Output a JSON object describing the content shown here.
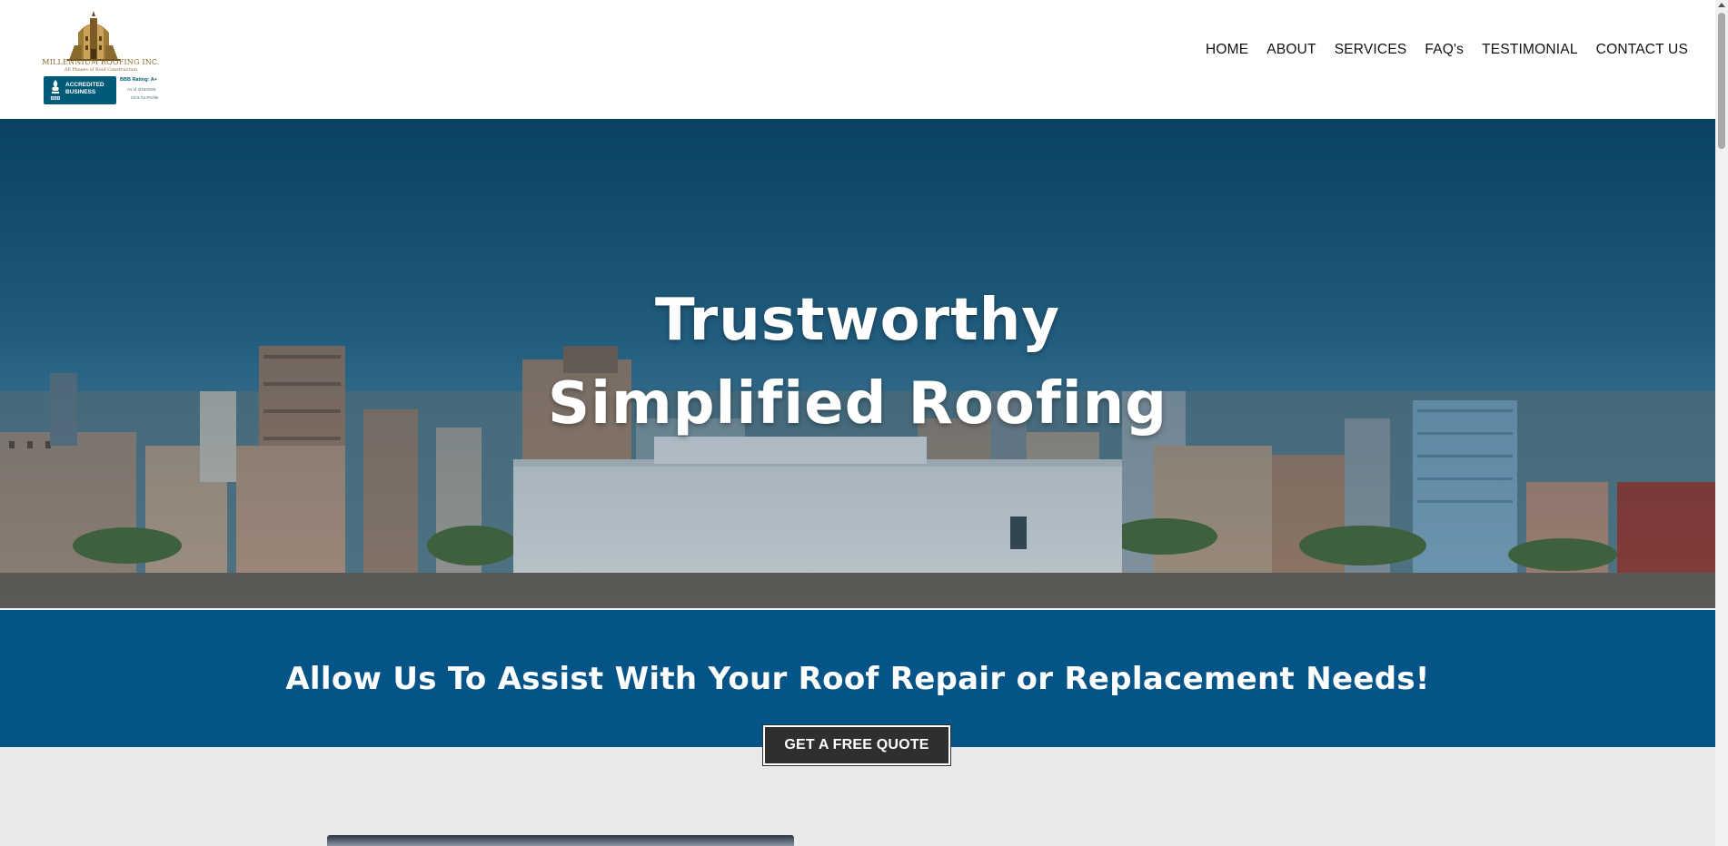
{
  "header": {
    "logo": {
      "company_name": "MILLENNIUM ROOFING INC.",
      "tagline": "All Phases of Roof Construction",
      "bbb": {
        "badge_line1": "ACCREDITED",
        "badge_line2": "BUSINESS",
        "bbb_label": "BBB",
        "rating": "BBB Rating: A+",
        "as_of": "As of 3/16/2025",
        "click": "Click for Profile"
      }
    },
    "nav": [
      {
        "label": "HOME"
      },
      {
        "label": "ABOUT"
      },
      {
        "label": "SERVICES"
      },
      {
        "label": "FAQ's"
      },
      {
        "label": "TESTIMONIAL"
      },
      {
        "label": "CONTACT US"
      }
    ]
  },
  "hero": {
    "title_line1": "Trustworthy",
    "title_line2": "Simplified Roofing"
  },
  "band": {
    "text": "Allow Us To Assist With Your Roof Repair or Replacement Needs!",
    "cta_label": "GET A FREE QUOTE"
  },
  "colors": {
    "band_blue": "#045487",
    "button_dark": "#2f2f2f",
    "section_grey": "#e9e9e9",
    "logo_gold": "#8a6a2a",
    "bbb_blue": "#005a78"
  }
}
